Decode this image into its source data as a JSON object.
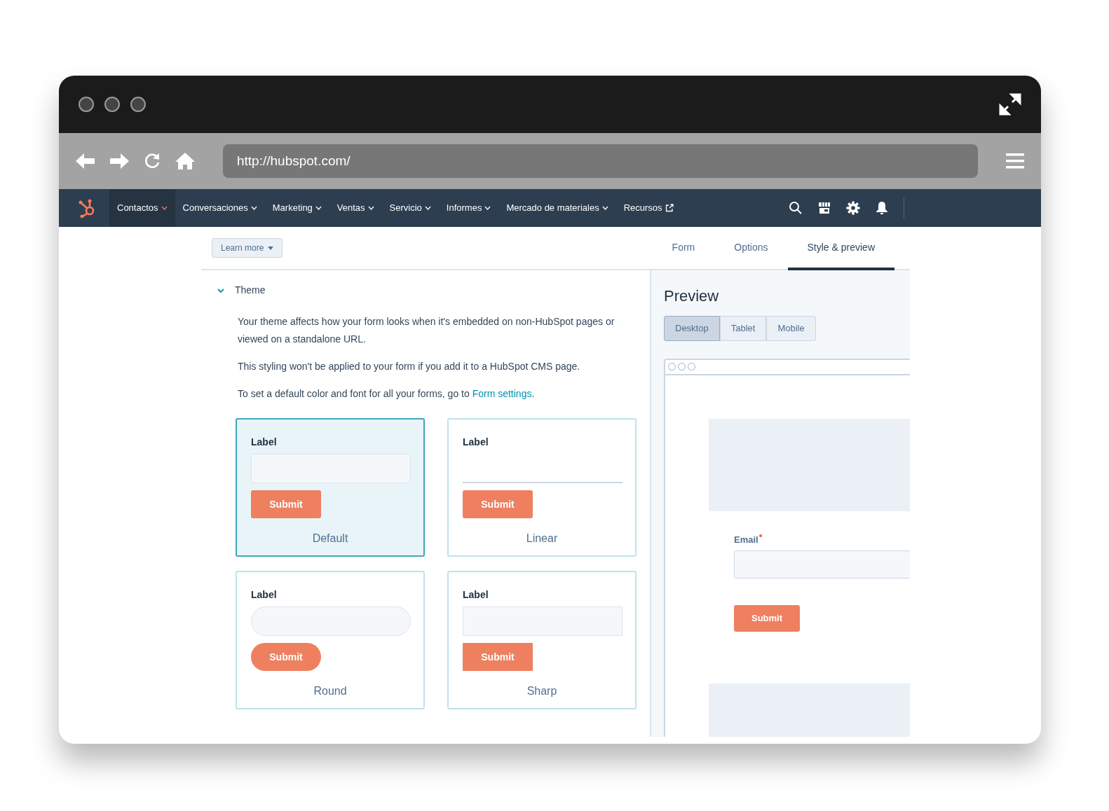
{
  "browser": {
    "url": "http://hubspot.com/"
  },
  "nav": {
    "items": [
      {
        "label": "Contactos",
        "selected": true,
        "kind": "menu"
      },
      {
        "label": "Conversaciones",
        "selected": false,
        "kind": "menu"
      },
      {
        "label": "Marketing",
        "selected": false,
        "kind": "menu"
      },
      {
        "label": "Ventas",
        "selected": false,
        "kind": "menu"
      },
      {
        "label": "Servicio",
        "selected": false,
        "kind": "menu"
      },
      {
        "label": "Informes",
        "selected": false,
        "kind": "menu"
      },
      {
        "label": "Mercado de materiales",
        "selected": false,
        "kind": "menu"
      },
      {
        "label": "Recursos",
        "selected": false,
        "kind": "external"
      }
    ]
  },
  "learn_more": "Learn more",
  "tabs": [
    {
      "label": "Form",
      "selected": false
    },
    {
      "label": "Options",
      "selected": false
    },
    {
      "label": "Style & preview",
      "selected": true
    }
  ],
  "section": {
    "title": "Theme",
    "expanded": true,
    "paragraphs": [
      {
        "text": "Your theme affects how your form looks when it's embedded on non-HubSpot pages or viewed on a standalone URL."
      },
      {
        "text": "This styling won't be applied to your form if you add it to a HubSpot CMS page."
      },
      {
        "text": "To set a default color and font for all your forms, go to ",
        "link": "Form settings",
        "after": "."
      }
    ]
  },
  "themes": [
    {
      "name": "Default",
      "kind": "default",
      "selected": true,
      "label": "Label",
      "button": "Submit"
    },
    {
      "name": "Linear",
      "kind": "linear",
      "selected": false,
      "label": "Label",
      "button": "Submit"
    },
    {
      "name": "Round",
      "kind": "round",
      "selected": false,
      "label": "Label",
      "button": "Submit"
    },
    {
      "name": "Sharp",
      "kind": "sharp",
      "selected": false,
      "label": "Label",
      "button": "Submit"
    }
  ],
  "preview": {
    "title": "Preview",
    "devices": [
      {
        "label": "Desktop",
        "selected": true
      },
      {
        "label": "Tablet",
        "selected": false
      },
      {
        "label": "Mobile",
        "selected": false
      }
    ],
    "field_label": "Email",
    "required": true,
    "button": "Submit"
  }
}
